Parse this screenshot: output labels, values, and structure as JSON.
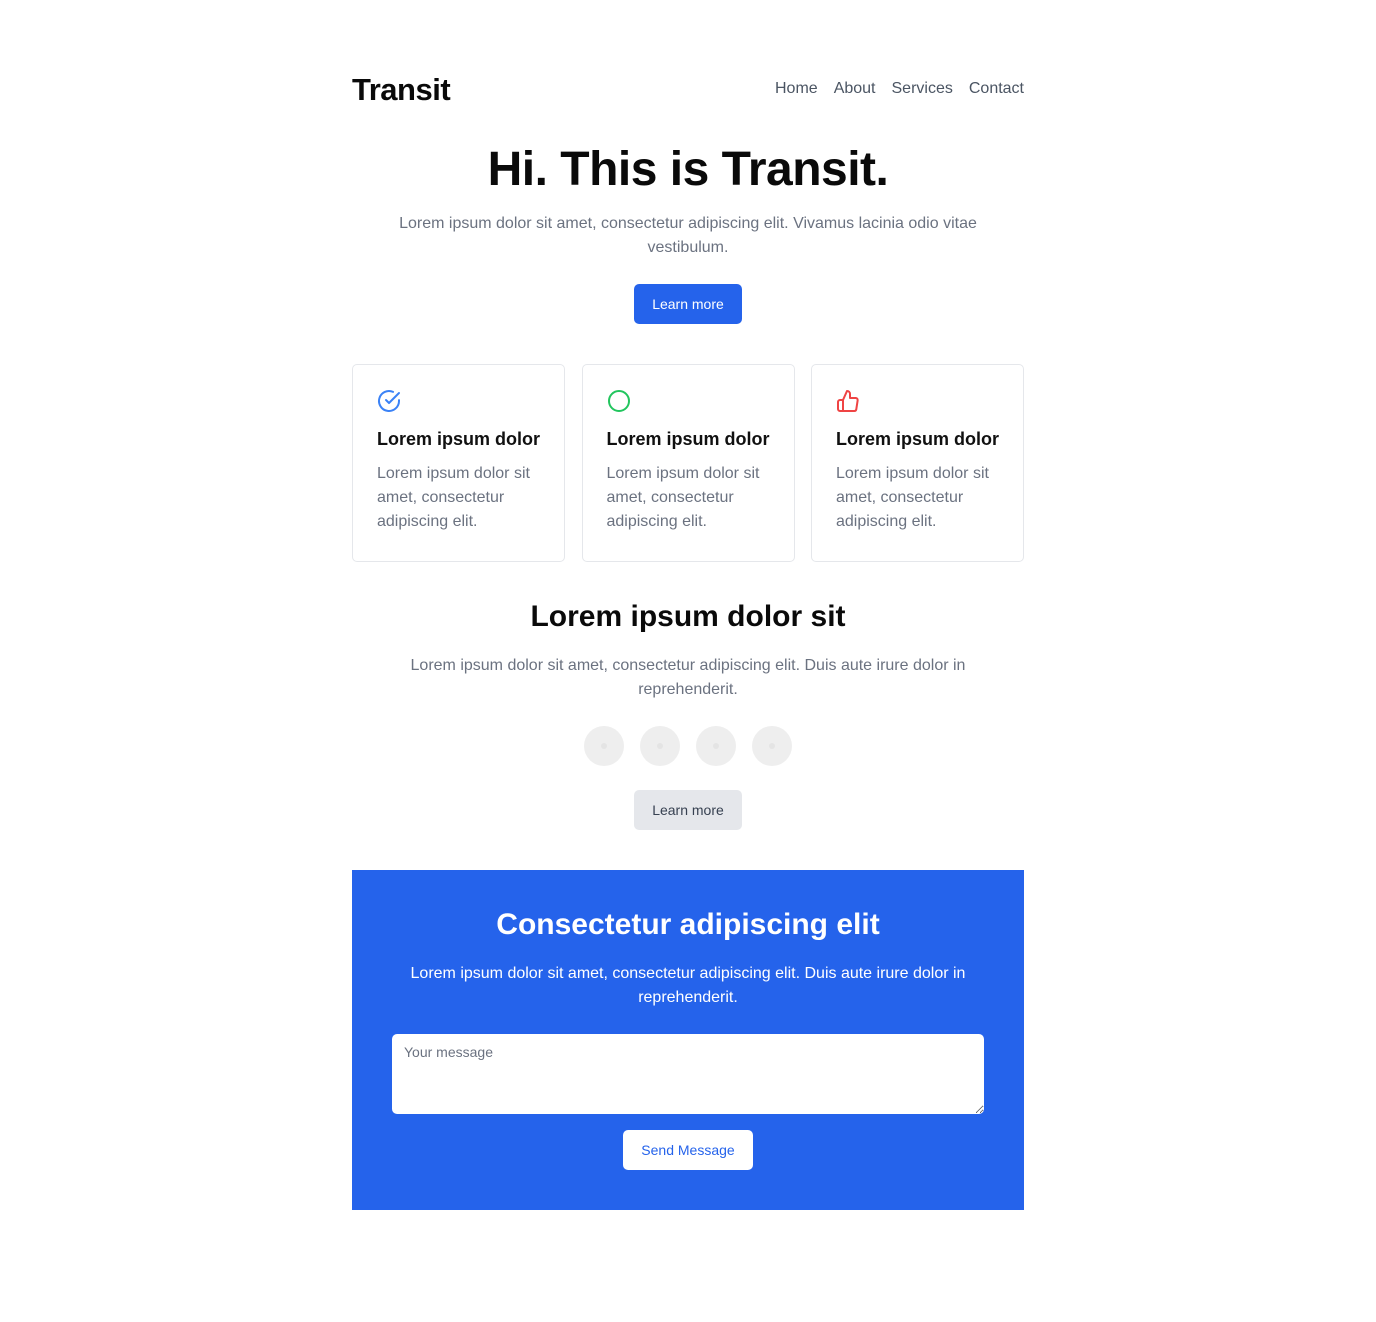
{
  "header": {
    "logo": "Transit",
    "nav": [
      "Home",
      "About",
      "Services",
      "Contact"
    ]
  },
  "hero": {
    "title": "Hi. This is Transit.",
    "subtitle": "Lorem ipsum dolor sit amet, consectetur adipiscing elit. Vivamus lacinia odio vitae vestibulum.",
    "button_label": "Learn more",
    "button_color": "#2563eb"
  },
  "features": [
    {
      "icon": "check-circle-icon",
      "icon_color": "#3b82f6",
      "title": "Lorem ipsum dolor",
      "text": "Lorem ipsum dolor sit amet, consectetur adipiscing elit."
    },
    {
      "icon": "circle-icon",
      "icon_color": "#22c55e",
      "title": "Lorem ipsum dolor",
      "text": "Lorem ipsum dolor sit amet, consectetur adipiscing elit."
    },
    {
      "icon": "thumbs-up-icon",
      "icon_color": "#ef4444",
      "title": "Lorem ipsum dolor",
      "text": "Lorem ipsum dolor sit amet, consectetur adipiscing elit."
    }
  ],
  "section2": {
    "title": "Lorem ipsum dolor sit",
    "subtitle": "Lorem ipsum dolor sit amet, consectetur adipiscing elit. Duis aute irure dolor in reprehenderit.",
    "avatar_count": 4,
    "button_label": "Learn more"
  },
  "cta": {
    "title": "Consectetur adipiscing elit",
    "subtitle": "Lorem ipsum dolor sit amet, consectetur adipiscing elit. Duis aute irure dolor in reprehenderit.",
    "textarea_placeholder": "Your message",
    "textarea_value": "",
    "button_label": "Send Message",
    "background_color": "#2563eb"
  }
}
